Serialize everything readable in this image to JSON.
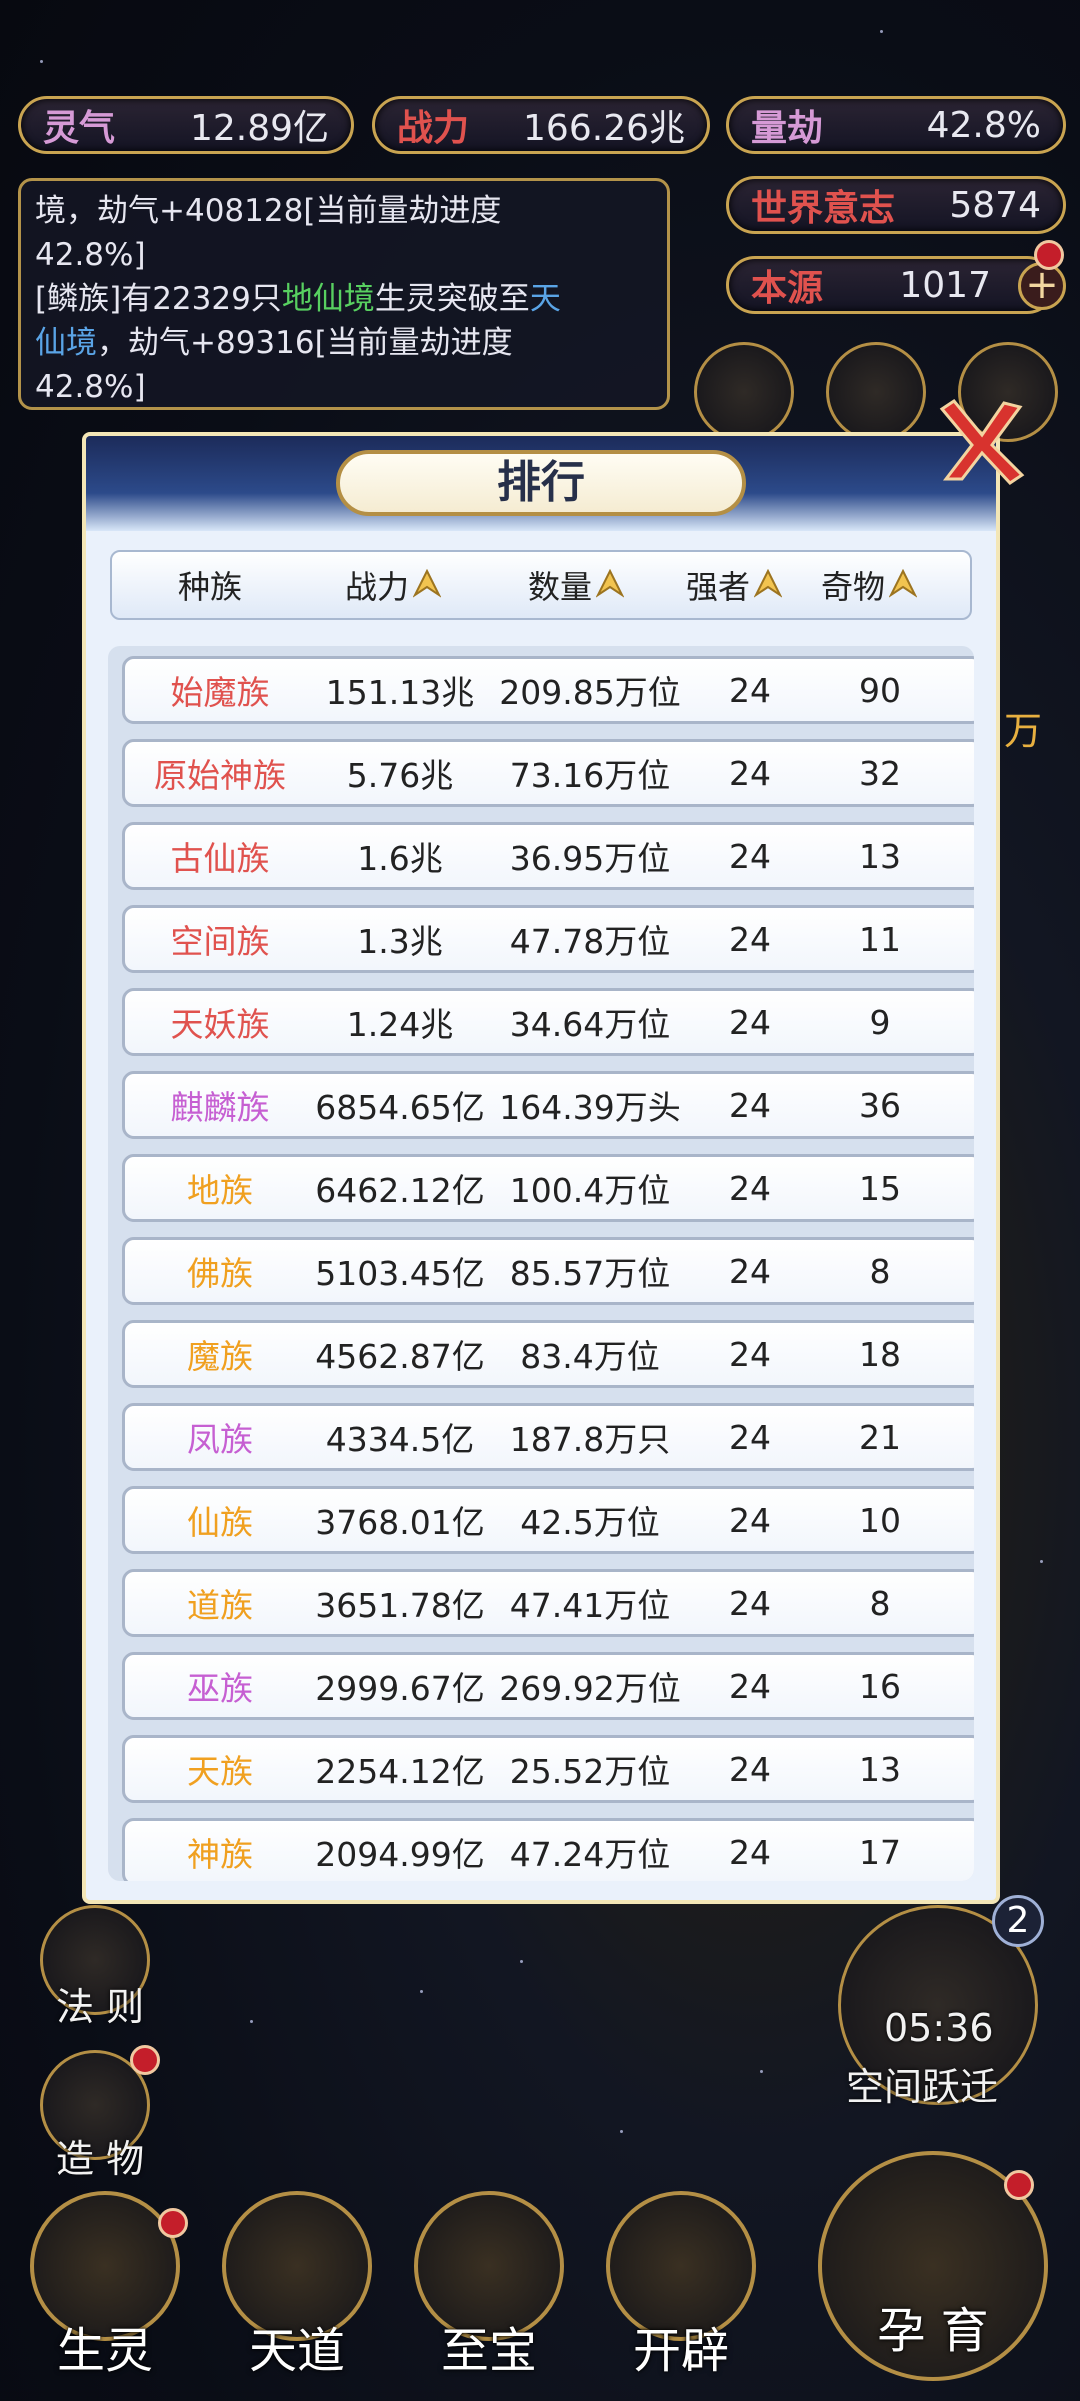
{
  "resources": {
    "lingqi": {
      "label": "灵气",
      "value": "12.89亿"
    },
    "zhanli": {
      "label": "战力",
      "value": "166.26兆"
    },
    "liangjie": {
      "label": "量劫",
      "value": "42.8%"
    },
    "shijieyizhi": {
      "label": "世界意志",
      "value": "5874"
    },
    "benyuan": {
      "label": "本源",
      "value": "1017"
    }
  },
  "log": {
    "line1_a": "境，劫气+408128[当前量劫进度",
    "line1_b": "42.8%]",
    "line2_pre": "[鳞族]有22329只",
    "line2_green": "地仙境",
    "line2_mid": "生灵突破至",
    "line2_blue1": "天",
    "line3_blue": "仙境",
    "line3_rest": "，劫气+89316[当前量劫进度",
    "line4": "42.8%]"
  },
  "side": {
    "fazhe": "法 则",
    "zaowu": "造 物",
    "timer": "05:36",
    "kongjian": "空间跃迁",
    "badge_count": "2",
    "wan_fragment": "万"
  },
  "nav": {
    "shengling": "生灵",
    "tiandao": "天道",
    "zhibao": "至宝",
    "kaipi": "开辟",
    "yunyu": "孕 育"
  },
  "modal": {
    "title": "排行",
    "headers": [
      "种族",
      "战力",
      "数量",
      "强者",
      "奇物"
    ],
    "rows": [
      {
        "race": "始魔族",
        "power": "151.13兆",
        "count": "209.85万位",
        "strong": "24",
        "items": "90",
        "color": "#e0524e"
      },
      {
        "race": "原始神族",
        "power": "5.76兆",
        "count": "73.16万位",
        "strong": "24",
        "items": "32",
        "color": "#e0524e"
      },
      {
        "race": "古仙族",
        "power": "1.6兆",
        "count": "36.95万位",
        "strong": "24",
        "items": "13",
        "color": "#e0524e"
      },
      {
        "race": "空间族",
        "power": "1.3兆",
        "count": "47.78万位",
        "strong": "24",
        "items": "11",
        "color": "#e0524e"
      },
      {
        "race": "天妖族",
        "power": "1.24兆",
        "count": "34.64万位",
        "strong": "24",
        "items": "9",
        "color": "#e0524e"
      },
      {
        "race": "麒麟族",
        "power": "6854.65亿",
        "count": "164.39万头",
        "strong": "24",
        "items": "36",
        "color": "#c65fd2"
      },
      {
        "race": "地族",
        "power": "6462.12亿",
        "count": "100.4万位",
        "strong": "24",
        "items": "15",
        "color": "#f0a020"
      },
      {
        "race": "佛族",
        "power": "5103.45亿",
        "count": "85.57万位",
        "strong": "24",
        "items": "8",
        "color": "#f0a020"
      },
      {
        "race": "魔族",
        "power": "4562.87亿",
        "count": "83.4万位",
        "strong": "24",
        "items": "18",
        "color": "#f0a020"
      },
      {
        "race": "凤族",
        "power": "4334.5亿",
        "count": "187.8万只",
        "strong": "24",
        "items": "21",
        "color": "#c65fd2"
      },
      {
        "race": "仙族",
        "power": "3768.01亿",
        "count": "42.5万位",
        "strong": "24",
        "items": "10",
        "color": "#f0a020"
      },
      {
        "race": "道族",
        "power": "3651.78亿",
        "count": "47.41万位",
        "strong": "24",
        "items": "8",
        "color": "#f0a020"
      },
      {
        "race": "巫族",
        "power": "2999.67亿",
        "count": "269.92万位",
        "strong": "24",
        "items": "16",
        "color": "#c65fd2"
      },
      {
        "race": "天族",
        "power": "2254.12亿",
        "count": "25.52万位",
        "strong": "24",
        "items": "13",
        "color": "#f0a020"
      },
      {
        "race": "神族",
        "power": "2094.99亿",
        "count": "47.24万位",
        "strong": "24",
        "items": "17",
        "color": "#f0a020"
      }
    ]
  }
}
